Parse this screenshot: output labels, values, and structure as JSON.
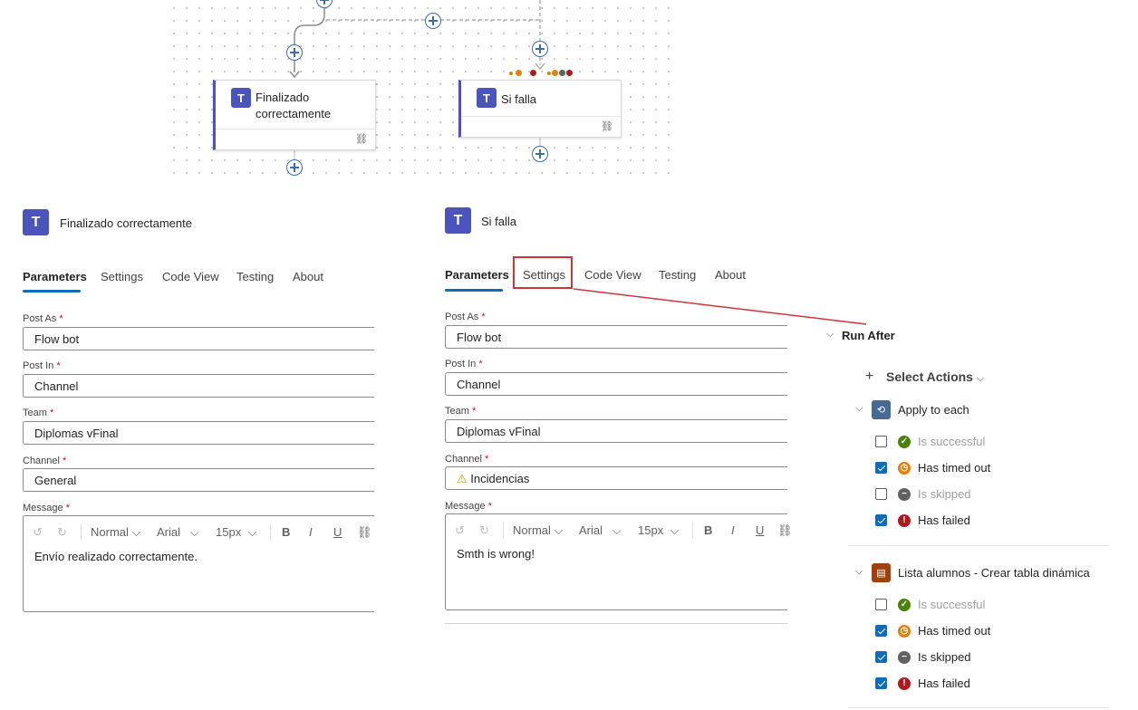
{
  "canvas": {
    "card_left_title_1": "Finalizado",
    "card_left_title_2": "correctamente",
    "card_right_title": "Si falla",
    "teams_glyph": "T",
    "link_glyph": "⛓",
    "colors": {
      "teams": "#4b53bc",
      "connector": "#3a6ea5"
    }
  },
  "left_panel": {
    "title": "Finalizado correctamente",
    "tabs": [
      "Parameters",
      "Settings",
      "Code View",
      "Testing",
      "About"
    ],
    "fields": {
      "post_as": {
        "label": "Post As",
        "value": "Flow bot"
      },
      "post_in": {
        "label": "Post In",
        "value": "Channel"
      },
      "team": {
        "label": "Team",
        "value": "Diplomas vFinal"
      },
      "channel": {
        "label": "Channel",
        "value": "General"
      },
      "message": {
        "label": "Message",
        "value": "Envío realizado correctamente."
      }
    },
    "toolbar": {
      "undo": "↺",
      "redo": "↻",
      "format": "Normal",
      "font": "Arial",
      "size": "15px",
      "bold": "B",
      "italic": "I",
      "underline": "U",
      "link": "⛓",
      "caret": "⌵"
    }
  },
  "right_panel": {
    "title": "Si falla",
    "tabs": [
      "Parameters",
      "Settings",
      "Code View",
      "Testing",
      "About"
    ],
    "fields": {
      "post_as": {
        "label": "Post As",
        "value": "Flow bot"
      },
      "post_in": {
        "label": "Post In",
        "value": "Channel"
      },
      "team": {
        "label": "Team",
        "value": "Diplomas vFinal"
      },
      "channel": {
        "label": "Channel",
        "value": "Incidencias",
        "warning": "⚠"
      },
      "message": {
        "label": "Message",
        "value": "Smth is wrong!"
      }
    },
    "toolbar": {
      "undo": "↺",
      "redo": "↻",
      "format": "Normal",
      "font": "Arial",
      "size": "15px",
      "bold": "B",
      "italic": "I",
      "underline": "U",
      "link": "⛓",
      "caret": "⌵"
    }
  },
  "required_mark": "*",
  "highlight_color": "#d13438",
  "run_after": {
    "title": "Run After",
    "select_actions": "Select Actions",
    "plus": "+",
    "chevron_down": "⌵",
    "actions": [
      {
        "name": "Apply to each",
        "icon": "loop-icon",
        "icon_glyph": "⟲",
        "icon_color": "#486991",
        "conditions": [
          {
            "label": "Is successful",
            "checked": false,
            "status": "success"
          },
          {
            "label": "Has timed out",
            "checked": true,
            "status": "timeout"
          },
          {
            "label": "Is skipped",
            "checked": false,
            "status": "skipped"
          },
          {
            "label": "Has failed",
            "checked": true,
            "status": "failed"
          }
        ]
      },
      {
        "name": "Lista alumnos - Crear tabla dinámica",
        "icon": "table-icon",
        "icon_glyph": "▤",
        "icon_color": "#a0410d",
        "conditions": [
          {
            "label": "Is successful",
            "checked": false,
            "status": "success"
          },
          {
            "label": "Has timed out",
            "checked": true,
            "status": "timeout"
          },
          {
            "label": "Is skipped",
            "checked": true,
            "status": "skipped"
          },
          {
            "label": "Has failed",
            "checked": true,
            "status": "failed"
          }
        ]
      }
    ],
    "status_glyphs": {
      "success": "✓",
      "timeout": "◷",
      "skipped": "−",
      "failed": "!"
    },
    "status_colors": {
      "success": "#498205",
      "timeout": "#e3810b",
      "skipped": "#616161",
      "failed": "#b1191d"
    }
  }
}
